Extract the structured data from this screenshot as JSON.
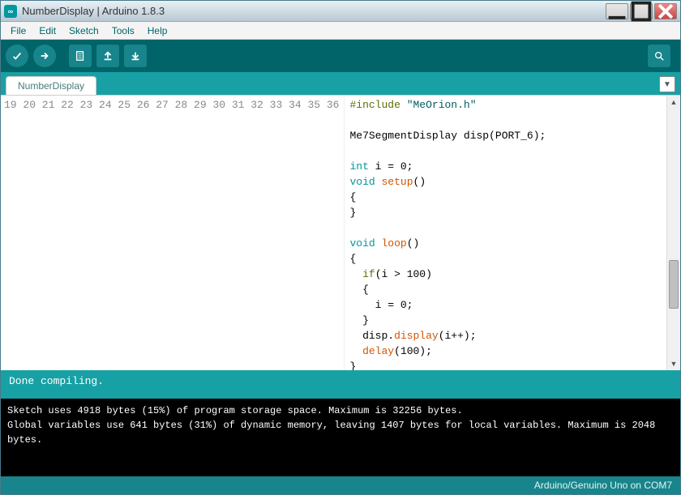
{
  "window": {
    "title": "NumberDisplay | Arduino 1.8.3"
  },
  "menu": {
    "file": "File",
    "edit": "Edit",
    "sketch": "Sketch",
    "tools": "Tools",
    "help": "Help"
  },
  "tabs": {
    "active": "NumberDisplay"
  },
  "editor": {
    "first_line": 19,
    "lines": [
      [
        [
          "pre",
          "#include"
        ],
        [
          "plain",
          " "
        ],
        [
          "str",
          "\"MeOrion.h\""
        ]
      ],
      [],
      [
        [
          "plain",
          "Me7SegmentDisplay disp(PORT_6);"
        ]
      ],
      [],
      [
        [
          "type",
          "int"
        ],
        [
          "plain",
          " i = 0;"
        ]
      ],
      [
        [
          "type",
          "void"
        ],
        [
          "plain",
          " "
        ],
        [
          "fn",
          "setup"
        ],
        [
          "plain",
          "()"
        ]
      ],
      [
        [
          "plain",
          "{"
        ]
      ],
      [
        [
          "plain",
          "}"
        ]
      ],
      [],
      [
        [
          "type",
          "void"
        ],
        [
          "plain",
          " "
        ],
        [
          "fn",
          "loop"
        ],
        [
          "plain",
          "()"
        ]
      ],
      [
        [
          "plain",
          "{"
        ]
      ],
      [
        [
          "plain",
          "  "
        ],
        [
          "kw",
          "if"
        ],
        [
          "plain",
          "(i > 100)"
        ]
      ],
      [
        [
          "plain",
          "  {"
        ]
      ],
      [
        [
          "plain",
          "    i = 0;"
        ]
      ],
      [
        [
          "plain",
          "  }"
        ]
      ],
      [
        [
          "plain",
          "  disp."
        ],
        [
          "fn",
          "display"
        ],
        [
          "plain",
          "(i++);"
        ]
      ],
      [
        [
          "plain",
          "  "
        ],
        [
          "fn",
          "delay"
        ],
        [
          "plain",
          "(100);"
        ]
      ],
      [
        [
          "plain",
          "}"
        ]
      ]
    ]
  },
  "status": {
    "text": "Done compiling."
  },
  "console": {
    "lines": [
      "",
      "Sketch uses 4918 bytes (15%) of program storage space. Maximum is 32256 bytes.",
      "Global variables use 641 bytes (31%) of dynamic memory, leaving 1407 bytes for local variables. Maximum is 2048 bytes."
    ]
  },
  "footer": {
    "board": "Arduino/Genuino Uno on COM7"
  }
}
